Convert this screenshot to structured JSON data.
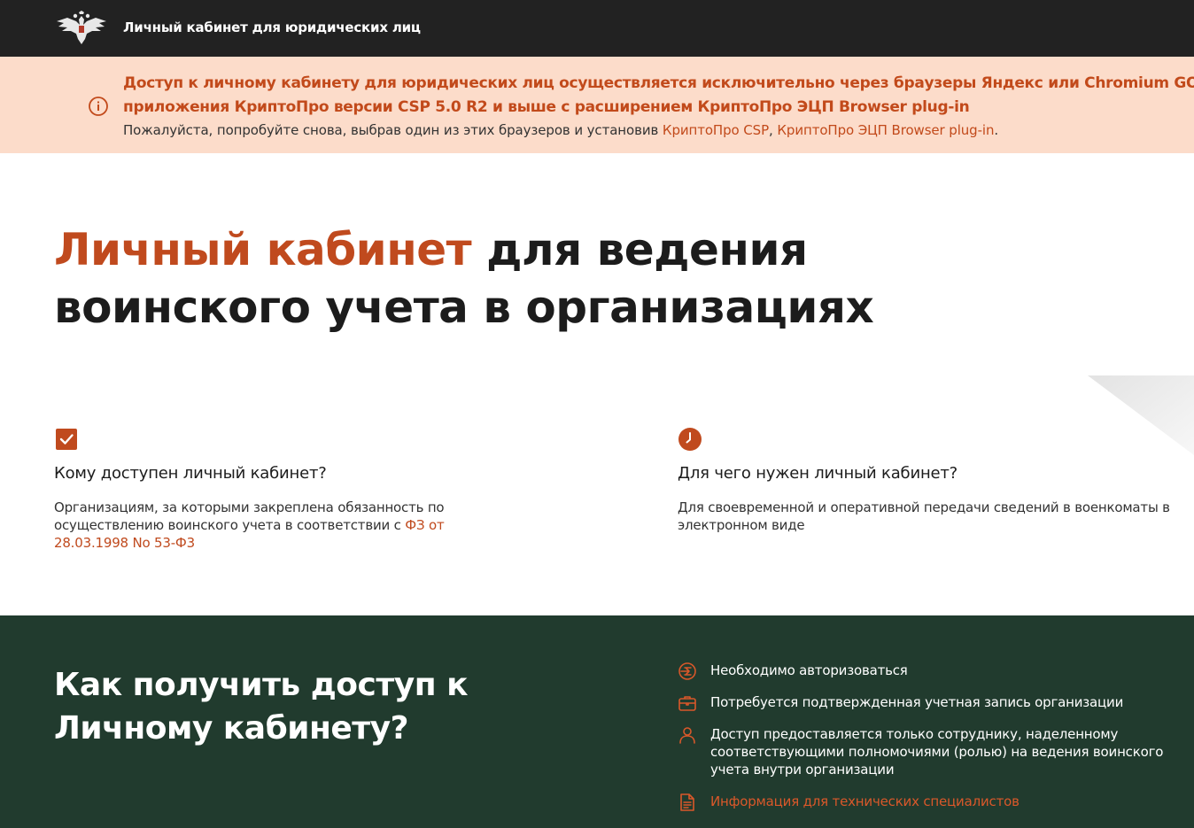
{
  "header": {
    "title": "Личный кабинет для юридических лиц",
    "emblem_icon": "double-headed-eagle-icon"
  },
  "alert": {
    "line1": "Доступ к личному кабинету для юридических лиц осуществляется исключительно через браузеры Яндекс или Chromium GOST, а также",
    "line2": "приложения КриптоПро версии CSP 5.0 R2 и выше с расширением КриптоПро ЭЦП Browser plug-in",
    "line3_prefix": "Пожалуйста, попробуйте снова, выбрав один из этих браузеров и установив ",
    "link1": "КриптоПро CSP",
    "separator": ", ",
    "link2": "КриптоПро ЭЦП Browser plug-in",
    "line3_suffix": ".",
    "icon": "info-icon"
  },
  "hero": {
    "title_accent": "Личный кабинет",
    "title_rest": " для ведения воинского учета в организациях"
  },
  "cards": {
    "left": {
      "icon": "checkbox-icon",
      "heading": "Кому доступен личный кабинет?",
      "text": "Организациям, за которыми закреплена обязанность по осуществлению воинского учета в соответствии с ",
      "link": "ФЗ от 28.03.1998 No 53-Ф3"
    },
    "right": {
      "icon": "clock-icon",
      "heading": "Для чего нужен личный кабинет?",
      "text": "Для своевременной и оперативной передачи сведений в военкоматы в электронном виде"
    }
  },
  "access": {
    "title": "Как получить доступ к Личному кабинету?",
    "items": [
      {
        "icon": "login-icon",
        "text": "Необходимо авторизоваться"
      },
      {
        "icon": "briefcase-icon",
        "text": "Потребуется подтвержденная учетная запись организации"
      },
      {
        "icon": "user-icon",
        "text": "Доступ предоставляется только сотруднику, наделенному соответствующими полномочиями (ролью) на ведения воинского учета внутри организации"
      },
      {
        "icon": "document-icon",
        "text": "Информация для технических специалистов"
      }
    ]
  },
  "colors": {
    "header_bg": "#222222",
    "alert_bg": "#fcdcca",
    "accent": "#c04a1e",
    "access_bg": "#213b2e"
  }
}
